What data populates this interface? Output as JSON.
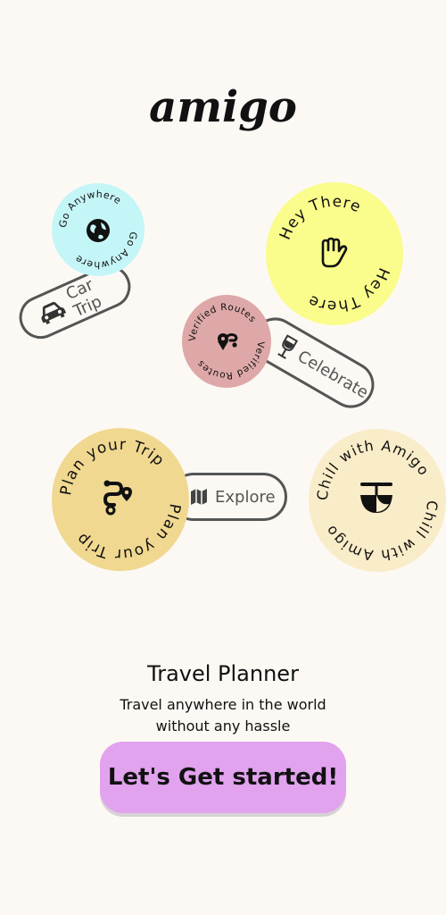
{
  "app": {
    "logo": "amigo"
  },
  "colors": {
    "background": "#fcf9f4",
    "cyan_circle": "#c5f6f7",
    "yellow_circle": "#fafc8c",
    "pink_circle": "#dea8a8",
    "gold_circle": "#f0d890",
    "cream_circle": "#f9ecc8",
    "cta_background": "#e1a2ee"
  },
  "badges": [
    {
      "text": "Go Anywhere",
      "icon": "globe-icon"
    },
    {
      "text": "Hey There",
      "icon": "hand-icon"
    },
    {
      "text": "Verified Routes",
      "icon": "route-pin-icon"
    },
    {
      "text": "Plan your Trip",
      "icon": "route-icon"
    },
    {
      "text": "Chill with Amigo",
      "icon": "beach-umbrella-icon"
    }
  ],
  "pills": [
    {
      "label": "Car Trip",
      "icon": "car-icon"
    },
    {
      "label": "Celebrate",
      "icon": "wine-glass-icon"
    },
    {
      "label": "Explore",
      "icon": "map-icon"
    }
  ],
  "intro": {
    "title": "Travel Planner",
    "subtitle_line1": "Travel anywhere in the world",
    "subtitle_line2": "without any hassle"
  },
  "cta": {
    "label": "Let's Get started!"
  }
}
